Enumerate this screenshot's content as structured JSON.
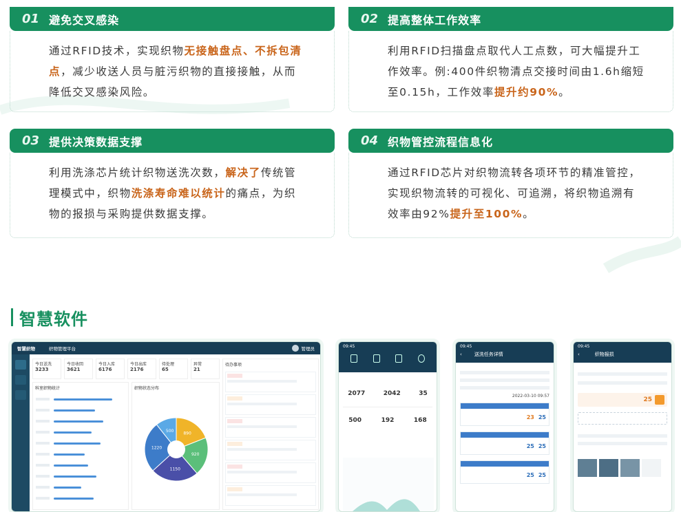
{
  "cards": [
    {
      "num": "01",
      "title": "避免交叉感染",
      "body": [
        {
          "t": "通过RFID技术，实现织物"
        },
        {
          "t": "无接触盘点、不拆包清点",
          "hl": true
        },
        {
          "t": "，减少收送人员与脏污织物的直接接触，从而降低交叉感染风险。"
        }
      ]
    },
    {
      "num": "02",
      "title": "提高整体工作效率",
      "body": [
        {
          "t": "利用RFID扫描盘点取代人工点数，可大幅提升工作效率。例:400件织物清点交接时间由1.6h缩短至0.15h，工作效率"
        },
        {
          "t": "提升约90%",
          "hl": true
        },
        {
          "t": "。"
        }
      ]
    },
    {
      "num": "03",
      "title": "提供决策数据支撑",
      "body": [
        {
          "t": "利用洗涤芯片统计织物送洗次数，"
        },
        {
          "t": "解决了",
          "hl": true
        },
        {
          "t": "传统管理模式中，织物"
        },
        {
          "t": "洗涤寿命难以统计",
          "hl": true
        },
        {
          "t": "的痛点，为织物的报损与采购提供数据支撑。"
        }
      ]
    },
    {
      "num": "04",
      "title": "织物管控流程信息化",
      "body": [
        {
          "t": "通过RFID芯片对织物流转各项环节的精准管控，实现织物流转的可视化、可追溯，将织物追溯有效率由92%"
        },
        {
          "t": "提升至100%",
          "hl": true
        },
        {
          "t": "。"
        }
      ]
    }
  ],
  "section": {
    "title": "智慧软件"
  },
  "dashboard": {
    "logo": "智慧织物",
    "title": "织物管理平台",
    "user": "管理员",
    "stats": [
      {
        "label": "今日送洗",
        "value": "3233"
      },
      {
        "label": "今日收回",
        "value": "3621"
      },
      {
        "label": "今日入库",
        "value": "6176"
      },
      {
        "label": "今日出库",
        "value": "2176"
      },
      {
        "label": "待处理",
        "value": "65"
      },
      {
        "label": "异常",
        "value": "21"
      }
    ],
    "pie": {
      "values": [
        890,
        920,
        1150,
        1220,
        500
      ],
      "colors": [
        "#f0b429",
        "#5bbf7a",
        "#4a4fa8",
        "#3d7cc9",
        "#5aa9e6"
      ]
    },
    "left_panel_title": "科室织物统计",
    "pie_title": "织物状态分布",
    "right_panel_title": "待办事项"
  },
  "phone1": {
    "time": "09:45",
    "nums_a": [
      "2077",
      "2042",
      "35"
    ],
    "nums_b": [
      "500",
      "192",
      "168"
    ]
  },
  "phone2": {
    "time": "09:45",
    "title": "送洗任务详情",
    "date": "2022-03-10 09:57",
    "rows": [
      {
        "a": "23",
        "b": "25"
      },
      {
        "a": "25",
        "b": "25"
      },
      {
        "a": "25",
        "b": "25"
      }
    ]
  },
  "phone3": {
    "time": "09:45",
    "title": "织物报损",
    "value": "25"
  }
}
